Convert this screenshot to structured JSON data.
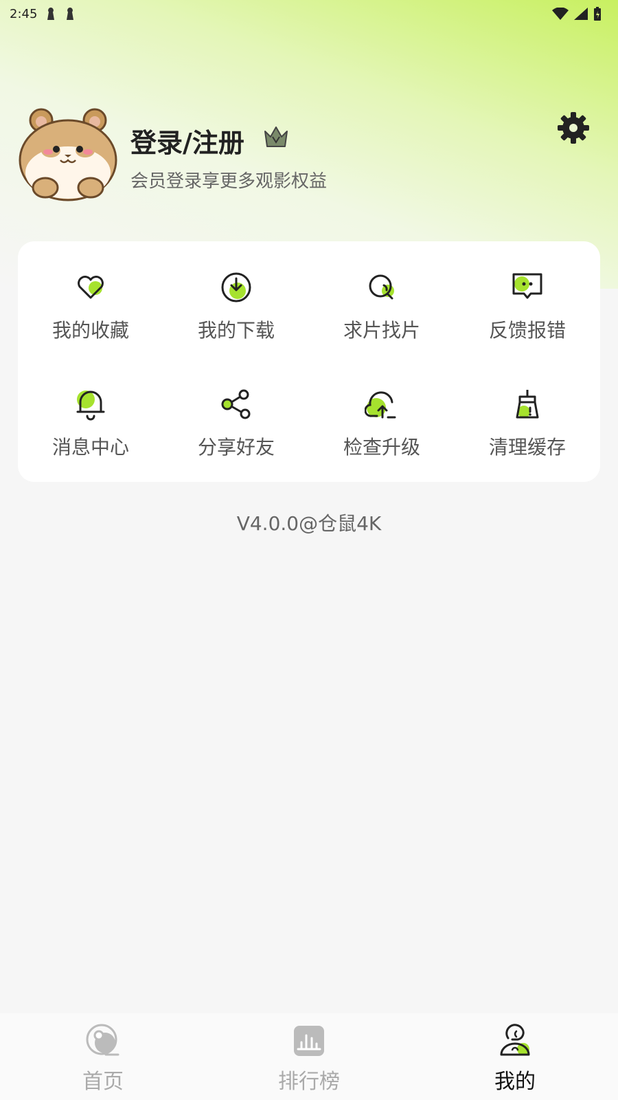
{
  "status_bar": {
    "time": "2:45"
  },
  "profile": {
    "title": "登录/注册",
    "subtitle": "会员登录享更多观影权益"
  },
  "menu": [
    {
      "label": "我的收藏",
      "icon": "heart-icon"
    },
    {
      "label": "我的下载",
      "icon": "download-icon"
    },
    {
      "label": "求片找片",
      "icon": "search-icon"
    },
    {
      "label": "反馈报错",
      "icon": "feedback-icon"
    },
    {
      "label": "消息中心",
      "icon": "bell-icon"
    },
    {
      "label": "分享好友",
      "icon": "share-icon"
    },
    {
      "label": "检查升级",
      "icon": "upgrade-icon"
    },
    {
      "label": "清理缓存",
      "icon": "broom-icon"
    }
  ],
  "version": "V4.0.0@仓鼠4K",
  "tabs": [
    {
      "label": "首页",
      "icon": "home-icon",
      "active": false
    },
    {
      "label": "排行榜",
      "icon": "ranking-icon",
      "active": false
    },
    {
      "label": "我的",
      "icon": "profile-icon",
      "active": true
    }
  ],
  "colors": {
    "accent": "#a6e22e",
    "icon_stroke": "#222222",
    "inactive": "#aaaaaa"
  }
}
